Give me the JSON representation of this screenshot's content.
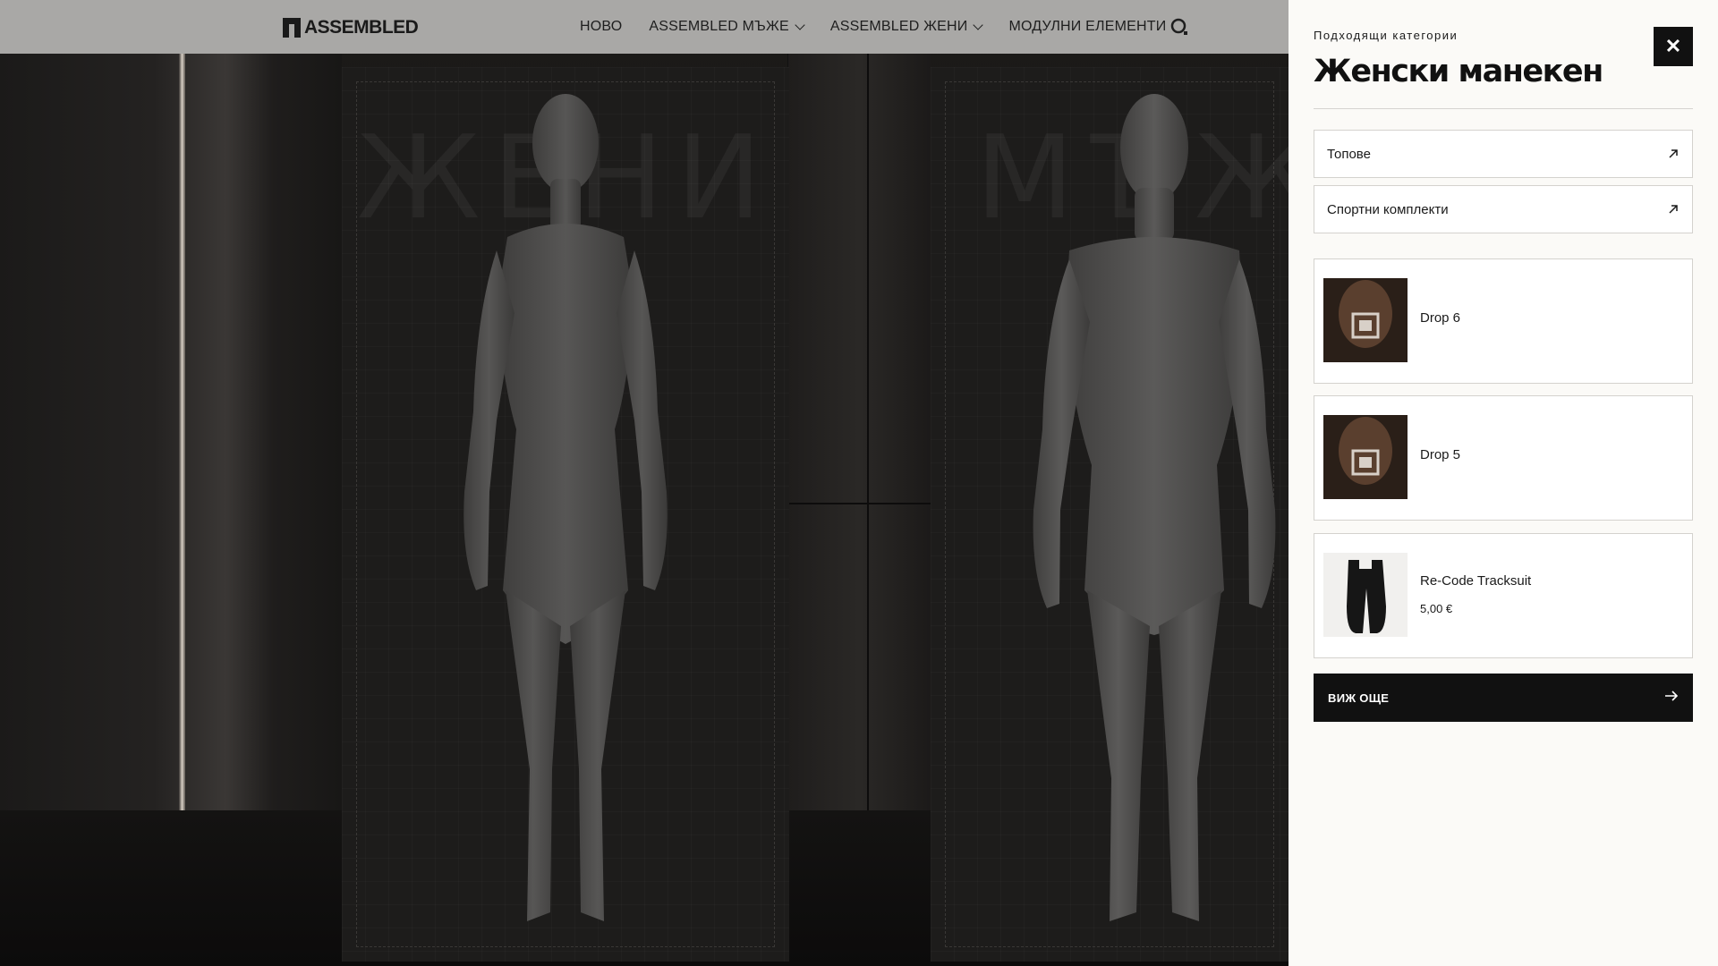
{
  "header": {
    "logo_text": "ASSEMBLED",
    "nav": [
      {
        "label": "НОВО",
        "has_dropdown": false
      },
      {
        "label": "ASSEMBLED МЪЖЕ",
        "has_dropdown": true
      },
      {
        "label": "ASSEMBLED ЖЕНИ",
        "has_dropdown": true
      },
      {
        "label": "МОДУЛНИ ЕЛЕМЕНТИ",
        "has_dropdown": false
      }
    ],
    "search_icon": "search-icon"
  },
  "scene": {
    "women_watermark": "ЖЕНИ",
    "men_watermark": "МЪЖЕ"
  },
  "drawer": {
    "subtitle": "Подходящи категории",
    "title": "Женски манекен",
    "close_icon": "close-icon",
    "categories": [
      {
        "label": "Топове",
        "icon": "arrow-up-right-icon"
      },
      {
        "label": "Спортни комплекти",
        "icon": "arrow-up-right-icon"
      }
    ],
    "products": [
      {
        "name": "Drop 6",
        "price": ""
      },
      {
        "name": "Drop 5",
        "price": ""
      },
      {
        "name": "Re-Code Tracksuit",
        "price": "5,00 €"
      }
    ],
    "more_button": {
      "label": "ВИЖ ОЩЕ",
      "icon": "arrow-right-icon"
    }
  },
  "colors": {
    "header_bg": "#a9a8a6",
    "drawer_bg": "#fbfaf7",
    "accent_dark": "#111111"
  }
}
